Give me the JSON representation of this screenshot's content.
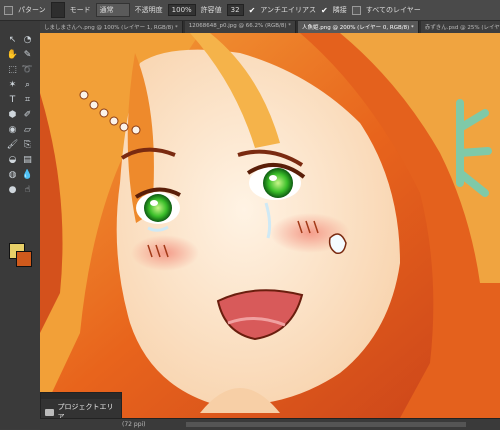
{
  "options": {
    "pattern_label": "パターン",
    "mode_label": "モード",
    "mode_value": "通常",
    "opacity_label": "不透明度",
    "opacity_value": "100%",
    "tolerance_label": "許容値",
    "tolerance_value": "32",
    "antialias_label": "アンチエイリアス",
    "contiguous_label": "隣接",
    "all_layers_label": "すべてのレイヤー"
  },
  "tabs": [
    {
      "label": "しましまさんへ.png @ 100% (レイヤー 1, RGB/8) *"
    },
    {
      "label": "12068648_p0.jpg @ 66.2% (RGB/8) *"
    },
    {
      "label": "人魚姫.png @ 200% (レイヤー 0, RGB/8) *"
    },
    {
      "label": "赤ずきん.psd @ 25% (レイヤー 7, RGB/8)"
    }
  ],
  "status": {
    "text": "(72 ppi)"
  },
  "project_panel": {
    "title": "プロジェクトエリア"
  },
  "colors": {
    "foreground": "#e8d068",
    "background": "#cf5a1c"
  },
  "tools": [
    "move-icon",
    "quick-select-icon",
    "hand-icon",
    "eyedropper-icon",
    "marquee-icon",
    "lasso-icon",
    "magic-wand-icon",
    "zoom-icon",
    "type-icon",
    "crop-icon",
    "shape-icon",
    "pen-icon",
    "redeye-icon",
    "eraser-icon",
    "brush-icon",
    "clone-icon",
    "paint-bucket-icon",
    "gradient-icon",
    "sponge-icon",
    "blur-icon",
    "dodge-icon",
    "smudge-icon"
  ]
}
